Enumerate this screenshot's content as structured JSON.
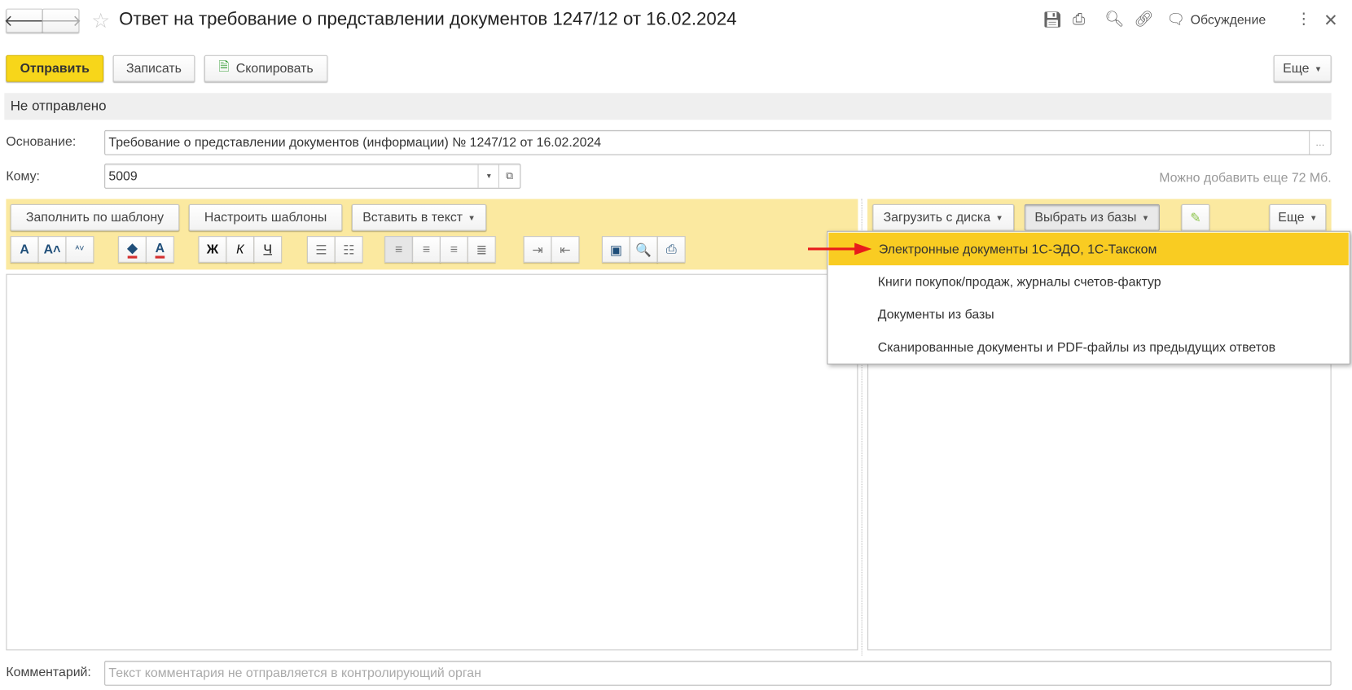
{
  "window": {
    "title": "Ответ на требование о представлении документов 1247/12 от 16.02.2024",
    "discussion_label": "Обсуждение",
    "icons": [
      "back-icon",
      "forward-icon",
      "star-icon",
      "save-icon",
      "print-icon",
      "preview-icon",
      "link-icon",
      "discussion-icon",
      "more-icon",
      "close-icon"
    ]
  },
  "commandbar": {
    "send": "Отправить",
    "write": "Записать",
    "copy": "Скопировать",
    "more": "Еще"
  },
  "status": "Не отправлено",
  "form": {
    "basis_label": "Основание:",
    "basis_value": "Требование о представлении документов (информации) № 1247/12 от 16.02.2024",
    "to_label": "Кому:",
    "to_value": "5009",
    "size_hint": "Можно добавить еще 72 Мб.",
    "comment_label": "Комментарий:",
    "comment_placeholder": "Текст комментария не отправляется в контролирующий орган"
  },
  "editor": {
    "fill_template": "Заполнить по шаблону",
    "setup_templates": "Настроить шаблоны",
    "insert_text": "Вставить в текст",
    "format_groups": [
      [
        {
          "name": "font-icon",
          "glyph": "A"
        },
        {
          "name": "font-increase-icon",
          "glyph": "A˄"
        },
        {
          "name": "font-decrease-icon",
          "glyph": "ᴬ˅"
        }
      ],
      [
        {
          "name": "fill-color-icon",
          "glyph": "◆"
        },
        {
          "name": "text-color-icon",
          "glyph": "A"
        }
      ],
      [
        {
          "name": "bold-icon",
          "glyph": "Ж"
        },
        {
          "name": "italic-icon",
          "glyph": "К"
        },
        {
          "name": "underline-icon",
          "glyph": "Ч"
        }
      ],
      [
        {
          "name": "bullet-list-icon",
          "glyph": "☰"
        },
        {
          "name": "numbered-list-icon",
          "glyph": "☷"
        }
      ],
      [
        {
          "name": "align-left-icon",
          "glyph": "≡",
          "pressed": true
        },
        {
          "name": "align-center-icon",
          "glyph": "≡"
        },
        {
          "name": "align-right-icon",
          "glyph": "≡"
        },
        {
          "name": "align-justify-icon",
          "glyph": "≣"
        }
      ],
      [
        {
          "name": "indent-increase-icon",
          "glyph": "⇥"
        },
        {
          "name": "indent-decrease-icon",
          "glyph": "⇤"
        }
      ],
      [
        {
          "name": "save-icon",
          "glyph": "▣"
        },
        {
          "name": "preview-icon",
          "glyph": "🔍"
        },
        {
          "name": "print-icon",
          "glyph": "⎙"
        }
      ]
    ]
  },
  "attachments": {
    "upload": "Загрузить с диска",
    "choose": "Выбрать из базы",
    "more": "Еще",
    "menu": [
      "Электронные документы 1С-ЭДО, 1С-Такском",
      "Книги покупок/продаж, журналы счетов-фактур",
      "Документы из базы",
      "Сканированные документы и PDF-файлы из предыдущих ответов"
    ],
    "highlighted_index": 0
  },
  "colors": {
    "accent": "#f7d61a",
    "panel": "#fbe9a0",
    "highlight": "#f9cc22",
    "arrow": "#e81b1b"
  }
}
